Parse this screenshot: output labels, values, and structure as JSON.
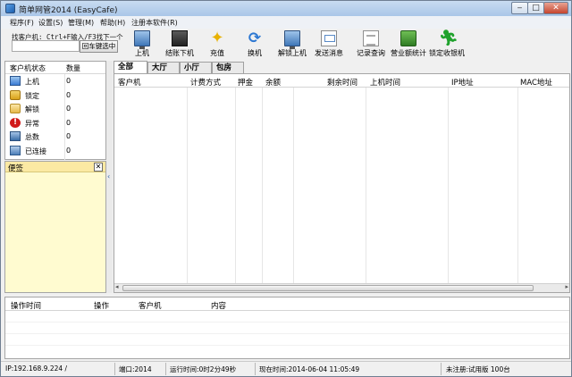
{
  "window": {
    "title": "简单网管2014 (EasyCafe)",
    "min_glyph": "‒",
    "max_glyph": "□",
    "close_glyph": "✕"
  },
  "menu": [
    "程序(F)",
    "设置(S)",
    "管理(M)",
    "帮助(H)",
    "注册本软件(R)"
  ],
  "find": {
    "label": "找客户机: Ctrl+F输入/F3找下一个",
    "value": "",
    "button": "回车键选中"
  },
  "toolbar": [
    {
      "label": "上机",
      "icon": "monitor-icon"
    },
    {
      "label": "结账下机",
      "icon": "checkout-icon"
    },
    {
      "label": "充值",
      "icon": "star-icon"
    },
    {
      "label": "换机",
      "icon": "refresh-icon"
    },
    {
      "label": "解锁上机",
      "icon": "unlock-monitor-icon"
    },
    {
      "label": "发送消息",
      "icon": "message-icon"
    },
    {
      "label": "记录查询",
      "icon": "records-icon"
    },
    {
      "label": "营业额统计",
      "icon": "revenue-icon"
    },
    {
      "label": "锁定收银机",
      "icon": "lock-cashier-icon"
    }
  ],
  "client_status": {
    "headers": [
      "客户机状态",
      "数量"
    ],
    "rows": [
      {
        "name": "上机",
        "count": "0",
        "icon": "online-icon",
        "color": "#3a7bd5"
      },
      {
        "name": "锁定",
        "count": "0",
        "icon": "lock-icon",
        "color": "#d9a21b"
      },
      {
        "name": "解锁",
        "count": "0",
        "icon": "unlock-icon",
        "color": "#e5b94a"
      },
      {
        "name": "异常",
        "count": "0",
        "icon": "warning-icon",
        "color": "#d11a1a"
      },
      {
        "name": "总数",
        "count": "0",
        "icon": "total-icon",
        "color": "#3a6ea8"
      },
      {
        "name": "已连接",
        "count": "0",
        "icon": "connected-icon",
        "color": "#4c7fb8"
      }
    ]
  },
  "notes": {
    "title": "便签",
    "close": "✕"
  },
  "splitter_glyph": "‹",
  "tabs": [
    "全部",
    "大厅",
    "小厅",
    "包房"
  ],
  "grid": {
    "headers": [
      "客户机",
      "计费方式",
      "押金",
      "余额",
      "剩余时间",
      "上机时间",
      "IP地址",
      "MAC地址"
    ],
    "scroll_left": "◂",
    "scroll_right": "▸"
  },
  "log": {
    "headers": [
      "操作时间",
      "操作",
      "客户机",
      "内容"
    ]
  },
  "status": {
    "ip": "IP:192.168.9.224 /",
    "port": "端口:2014",
    "runtime": "运行时间:0时2分49秒",
    "now": "现在时间:2014-06-04 11:05:49",
    "reg": "未注册:试用版 100台"
  },
  "colors": {
    "titlebar": "#b9d1ee",
    "notes_bg": "#fffbd0",
    "accent": "#3569a8"
  }
}
